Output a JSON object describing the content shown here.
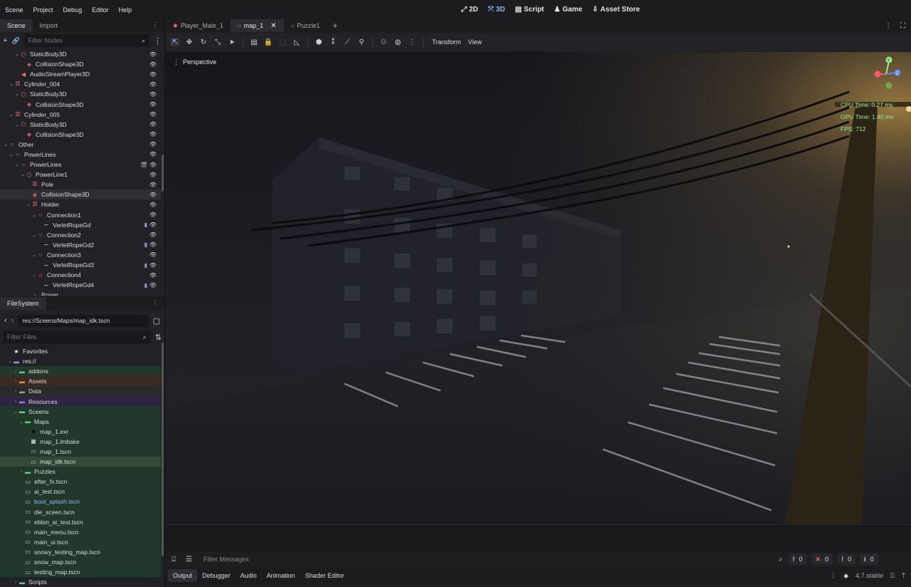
{
  "menubar": {
    "menus": [
      "Scene",
      "Project",
      "Debug",
      "Editor",
      "Help"
    ],
    "modes": [
      {
        "icon": "2d-icon",
        "glyph": "⤢",
        "label": "2D"
      },
      {
        "icon": "3d-icon",
        "glyph": "⤧",
        "label": "3D"
      },
      {
        "icon": "script-icon",
        "glyph": "▤",
        "label": "Script"
      },
      {
        "icon": "game-icon",
        "glyph": "♟",
        "label": "Game"
      },
      {
        "icon": "asset-store-icon",
        "glyph": "⇩",
        "label": "Asset Store"
      }
    ],
    "active_mode": "3D"
  },
  "scene_dock": {
    "tabs": [
      "Scene",
      "Import"
    ],
    "filter_placeholder": "Filter Nodes",
    "nodes": [
      {
        "depth": 2,
        "arrow": "⌄",
        "icon": "⬡",
        "color": "red",
        "label": "StaticBody3D",
        "eye": true
      },
      {
        "depth": 3,
        "arrow": "",
        "icon": "◈",
        "color": "red",
        "label": "CollisionShape3D",
        "eye": true
      },
      {
        "depth": 2,
        "arrow": "",
        "icon": "◀",
        "color": "red",
        "label": "AudioStreamPlayer3D",
        "eye": true
      },
      {
        "depth": 1,
        "arrow": "⌄",
        "icon": "⛝",
        "color": "red",
        "label": "Cylinder_004",
        "eye": true
      },
      {
        "depth": 2,
        "arrow": "⌄",
        "icon": "⬡",
        "color": "red",
        "label": "StaticBody3D",
        "eye": true
      },
      {
        "depth": 3,
        "arrow": "",
        "icon": "◈",
        "color": "red",
        "label": "CollisionShape3D",
        "eye": true
      },
      {
        "depth": 1,
        "arrow": "⌄",
        "icon": "⛝",
        "color": "red",
        "label": "Cylinder_005",
        "eye": true
      },
      {
        "depth": 2,
        "arrow": "⌄",
        "icon": "⬡",
        "color": "red",
        "label": "StaticBody3D",
        "eye": true
      },
      {
        "depth": 3,
        "arrow": "",
        "icon": "◈",
        "color": "red",
        "label": "CollisionShape3D",
        "eye": true
      },
      {
        "depth": 0,
        "arrow": "⌄",
        "icon": "○",
        "color": "red",
        "label": "Other",
        "eye": true
      },
      {
        "depth": 1,
        "arrow": "⌄",
        "icon": "○",
        "color": "red",
        "label": "PowerLines",
        "eye": true
      },
      {
        "depth": 2,
        "arrow": "⌄",
        "icon": "○",
        "color": "red",
        "label": "PowerLines",
        "eye": true,
        "film": true
      },
      {
        "depth": 3,
        "arrow": "⌄",
        "icon": "⬡",
        "color": "red",
        "label": "PowerLine1",
        "eye": true
      },
      {
        "depth": 4,
        "arrow": "",
        "icon": "⛝",
        "color": "red",
        "label": "Pole",
        "eye": true
      },
      {
        "depth": 4,
        "arrow": "",
        "icon": "◈",
        "color": "red",
        "label": "CollisionShape3D",
        "eye": true,
        "selected": true
      },
      {
        "depth": 4,
        "arrow": "⌄",
        "icon": "⛝",
        "color": "red",
        "label": "Holder",
        "eye": true
      },
      {
        "depth": 5,
        "arrow": "⌄",
        "icon": "○",
        "color": "red",
        "label": "Connection1",
        "eye": true
      },
      {
        "depth": 6,
        "arrow": "",
        "icon": "∼",
        "color": "white",
        "label": "VerletRopeGd",
        "eye": true,
        "script": true
      },
      {
        "depth": 5,
        "arrow": "⌄",
        "icon": "○",
        "color": "red",
        "label": "Connection2",
        "eye": true
      },
      {
        "depth": 6,
        "arrow": "",
        "icon": "∼",
        "color": "white",
        "label": "VerletRopeGd2",
        "eye": true,
        "script": true
      },
      {
        "depth": 5,
        "arrow": "⌄",
        "icon": "○",
        "color": "red",
        "label": "Connection3",
        "eye": true
      },
      {
        "depth": 6,
        "arrow": "",
        "icon": "∼",
        "color": "white",
        "label": "VerletRopeGd3",
        "eye": true,
        "script": true
      },
      {
        "depth": 5,
        "arrow": "⌄",
        "icon": "○",
        "color": "red",
        "label": "Connection4",
        "eye": true
      },
      {
        "depth": 6,
        "arrow": "",
        "icon": "∼",
        "color": "white",
        "label": "VerletRopeGd4",
        "eye": true,
        "script": true
      },
      {
        "depth": 4,
        "arrow": "",
        "icon": "○",
        "color": "red",
        "label": "Power",
        "eye": false
      }
    ]
  },
  "filesystem": {
    "title": "FileSystem",
    "path": "res://Sceens/Maps/map_idk.tscn",
    "filter_placeholder": "Filter Files",
    "items": [
      {
        "depth": 0,
        "arrow": "",
        "icon": "★",
        "kind": "star",
        "label": "Favorites",
        "hl": ""
      },
      {
        "depth": 0,
        "arrow": "⌄",
        "icon": "▬",
        "kind": "folder-blue",
        "label": "res://",
        "hl": ""
      },
      {
        "depth": 1,
        "arrow": "›",
        "icon": "▬",
        "kind": "folder-green",
        "label": "addons",
        "hl": "hl-green"
      },
      {
        "depth": 1,
        "arrow": "›",
        "icon": "▬",
        "kind": "folder-orange",
        "label": "Assets",
        "hl": "hl-orange"
      },
      {
        "depth": 1,
        "arrow": "›",
        "icon": "▬",
        "kind": "folder-gray",
        "label": "Data",
        "hl": "hl-gray"
      },
      {
        "depth": 1,
        "arrow": "›",
        "icon": "▬",
        "kind": "folder-purple",
        "label": "Resources",
        "hl": "hl-purple"
      },
      {
        "depth": 1,
        "arrow": "⌄",
        "icon": "▬",
        "kind": "folder-green",
        "label": "Sceens",
        "hl": "hl-green"
      },
      {
        "depth": 2,
        "arrow": "⌄",
        "icon": "▬",
        "kind": "folder-green",
        "label": "Maps",
        "hl": "hl-green"
      },
      {
        "depth": 3,
        "arrow": "",
        "icon": "■",
        "kind": "file-black",
        "label": "map_1.exr",
        "hl": "hl-green"
      },
      {
        "depth": 3,
        "arrow": "",
        "icon": "▦",
        "kind": "file",
        "label": "map_1.lmbake",
        "hl": "hl-green"
      },
      {
        "depth": 3,
        "arrow": "",
        "icon": "▭",
        "kind": "file",
        "label": "map_1.tscn",
        "hl": "hl-green"
      },
      {
        "depth": 3,
        "arrow": "",
        "icon": "▭",
        "kind": "file",
        "label": "map_idk.tscn",
        "hl": "hl-sel"
      },
      {
        "depth": 2,
        "arrow": "›",
        "icon": "▬",
        "kind": "folder-green",
        "label": "Puzzles",
        "hl": "hl-green"
      },
      {
        "depth": 2,
        "arrow": "",
        "icon": "▭",
        "kind": "file",
        "label": "after_fx.tscn",
        "hl": "hl-green"
      },
      {
        "depth": 2,
        "arrow": "",
        "icon": "▭",
        "kind": "file",
        "label": "ai_test.tscn",
        "hl": "hl-green"
      },
      {
        "depth": 2,
        "arrow": "",
        "icon": "▭",
        "kind": "file-blue",
        "label": "boot_splash.tscn",
        "hl": "hl-green"
      },
      {
        "depth": 2,
        "arrow": "",
        "icon": "▭",
        "kind": "file",
        "label": "die_sceen.tscn",
        "hl": "hl-green"
      },
      {
        "depth": 2,
        "arrow": "",
        "icon": "▭",
        "kind": "file",
        "label": "eblon_ai_test.tscn",
        "hl": "hl-green"
      },
      {
        "depth": 2,
        "arrow": "",
        "icon": "▭",
        "kind": "file",
        "label": "main_menu.tscn",
        "hl": "hl-green"
      },
      {
        "depth": 2,
        "arrow": "",
        "icon": "▭",
        "kind": "file",
        "label": "main_ui.tscn",
        "hl": "hl-green"
      },
      {
        "depth": 2,
        "arrow": "",
        "icon": "▭",
        "kind": "file",
        "label": "snowy_testing_map.tscn",
        "hl": "hl-green"
      },
      {
        "depth": 2,
        "arrow": "",
        "icon": "▭",
        "kind": "file",
        "label": "snow_map.tscn",
        "hl": "hl-green"
      },
      {
        "depth": 2,
        "arrow": "",
        "icon": "▭",
        "kind": "file",
        "label": "testing_map.tscn",
        "hl": "hl-green"
      },
      {
        "depth": 1,
        "arrow": "›",
        "icon": "▬",
        "kind": "folder-green",
        "label": "Scripts",
        "hl": ""
      }
    ]
  },
  "editor_tabs": [
    {
      "label": "Player_Male_1",
      "icon": "✱",
      "active": false,
      "closable": false
    },
    {
      "label": "map_1",
      "icon": "○",
      "active": true,
      "closable": true
    },
    {
      "label": "Puzzle1",
      "icon": "○",
      "active": false,
      "closable": false
    }
  ],
  "toolbar": {
    "transform_label": "Transform",
    "view_label": "View"
  },
  "viewport": {
    "perspective_label": "Perspective",
    "cpu_time": "CPU Time: 0.27 ms",
    "gpu_time": "GPU Time: 1.40 ms",
    "fps": "FPS: 712",
    "gizmo": {
      "y": "Y",
      "z": "Z"
    }
  },
  "bottom_panel": {
    "filter_placeholder": "Filter Messages",
    "counters": [
      {
        "icon": "!",
        "value": "0",
        "color": "#d0d0d0"
      },
      {
        "icon": "✕",
        "value": "0",
        "color": "#ff5a5a"
      },
      {
        "icon": "!",
        "value": "0",
        "color": "#f0c040"
      },
      {
        "icon": "i",
        "value": "0",
        "color": "#d0d0d0"
      }
    ],
    "tabs": [
      "Output",
      "Debugger",
      "Audio",
      "Animation",
      "Shader Editor"
    ],
    "active_tab": "Output",
    "version": "4.7.stable"
  }
}
